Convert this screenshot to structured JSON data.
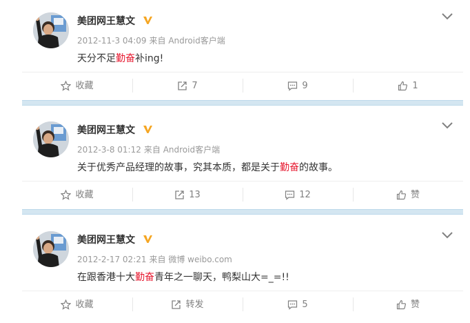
{
  "posts": [
    {
      "user": {
        "name": "美团网王慧文",
        "verified": true
      },
      "meta": {
        "time": "2012-11-3 04:09",
        "source": "来自 Android客户端"
      },
      "content": {
        "before": "天分不足",
        "highlight": "勤奋",
        "after": "补ing!"
      },
      "actions": {
        "favorite": "收藏",
        "repost": "7",
        "comment": "9",
        "like": "1"
      }
    },
    {
      "user": {
        "name": "美团网王慧文",
        "verified": true
      },
      "meta": {
        "time": "2012-3-8 01:12",
        "source": "来自 Android客户端"
      },
      "content": {
        "before": "关于优秀产品经理的故事，究其本质，都是关于",
        "highlight": "勤奋",
        "after": "的故事。"
      },
      "actions": {
        "favorite": "收藏",
        "repost": "13",
        "comment": "12",
        "like": "赞"
      }
    },
    {
      "user": {
        "name": "美团网王慧文",
        "verified": true
      },
      "meta": {
        "time": "2012-2-17 02:21",
        "source": "来自 微博 weibo.com"
      },
      "content": {
        "before": "在跟香港十大",
        "highlight": "勤奋",
        "after": "青年之一聊天，鸭梨山大=_=!!"
      },
      "actions": {
        "favorite": "收藏",
        "repost": "转发",
        "comment": "5",
        "like": "赞"
      }
    }
  ],
  "colors": {
    "highlight": "#e6162d",
    "divider": "#d4e6f1",
    "verified_badge": "#f5a623",
    "meta_text": "#999999"
  },
  "icons": {
    "favorite": "star-icon",
    "repost": "repost-icon",
    "comment": "comment-icon",
    "like": "thumbs-up-icon",
    "menu": "chevron-down-icon",
    "verified": "verified-v-badge-icon"
  }
}
